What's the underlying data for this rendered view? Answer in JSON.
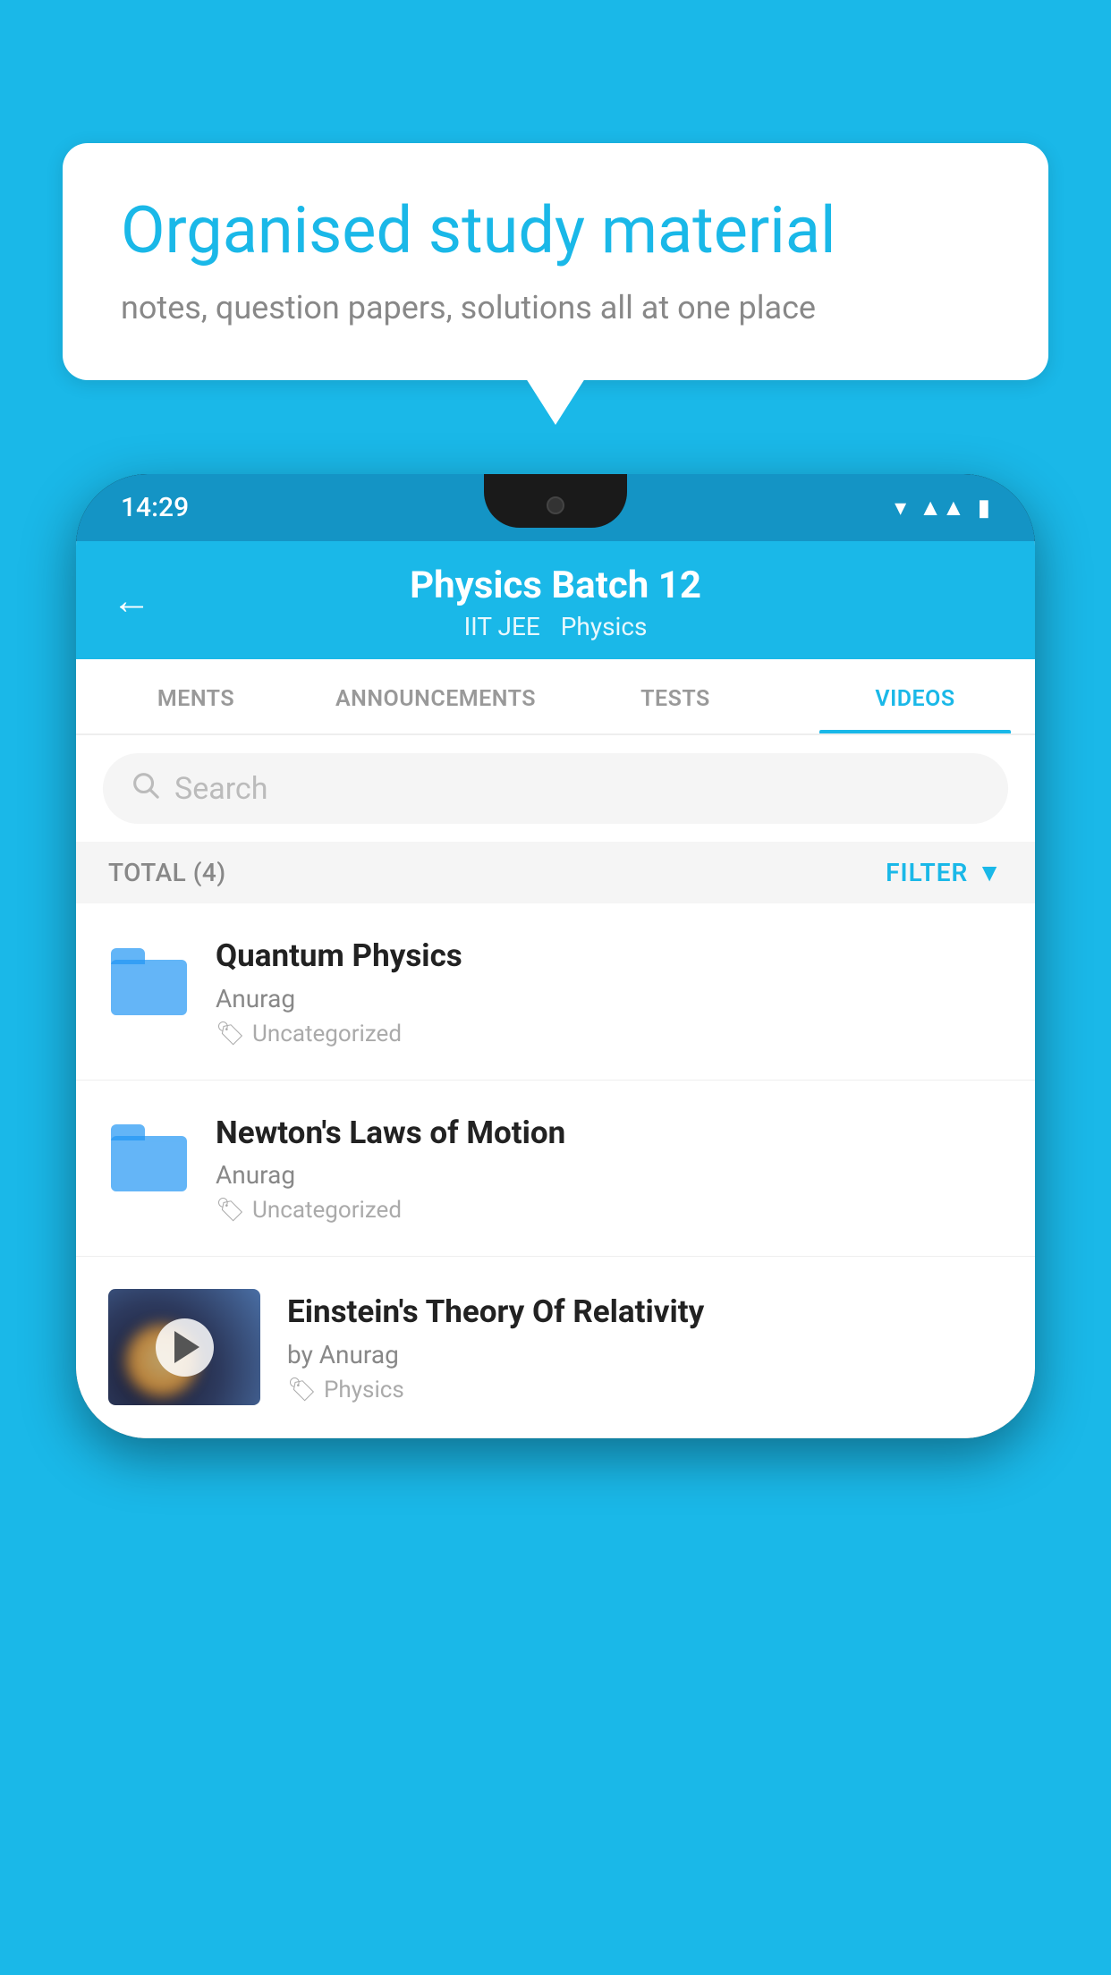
{
  "background": {
    "color": "#1ab8e8"
  },
  "speech_bubble": {
    "title": "Organised study material",
    "subtitle": "notes, question papers, solutions all at one place"
  },
  "phone": {
    "status_bar": {
      "time": "14:29"
    },
    "header": {
      "title": "Physics Batch 12",
      "breadcrumb_part1": "IIT JEE",
      "breadcrumb_part2": "Physics",
      "back_label": "←"
    },
    "tabs": [
      {
        "label": "MENTS",
        "active": false
      },
      {
        "label": "ANNOUNCEMENTS",
        "active": false
      },
      {
        "label": "TESTS",
        "active": false
      },
      {
        "label": "VIDEOS",
        "active": true
      }
    ],
    "search": {
      "placeholder": "Search"
    },
    "filter_bar": {
      "total_label": "TOTAL (4)",
      "filter_label": "FILTER"
    },
    "videos": [
      {
        "title": "Quantum Physics",
        "author": "Anurag",
        "tag": "Uncategorized",
        "type": "folder",
        "has_thumbnail": false
      },
      {
        "title": "Newton's Laws of Motion",
        "author": "Anurag",
        "tag": "Uncategorized",
        "type": "folder",
        "has_thumbnail": false
      },
      {
        "title": "Einstein's Theory Of Relativity",
        "author": "by Anurag",
        "tag": "Physics",
        "type": "video",
        "has_thumbnail": true
      }
    ]
  }
}
